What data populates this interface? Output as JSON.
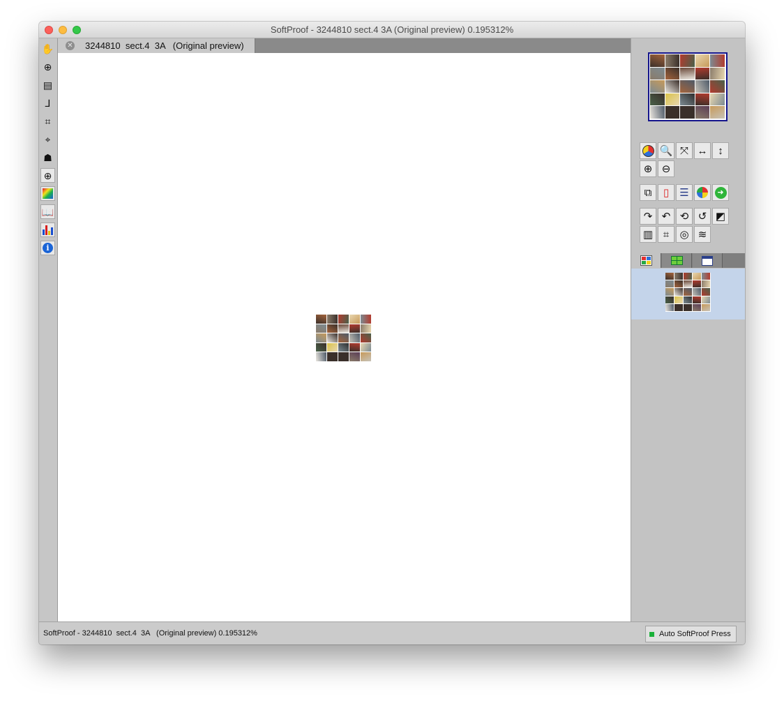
{
  "window": {
    "title": "SoftProof - 3244810  sect.4  3A   (Original preview) 0.195312%"
  },
  "left_toolbar": {
    "tools": [
      {
        "name": "hand-tool",
        "icon": "hand-icon",
        "glyph": "✋"
      },
      {
        "name": "zoom-tool",
        "icon": "zoom-in-icon",
        "glyph": "⊕"
      },
      {
        "name": "page-info-tool",
        "icon": "page-list-icon",
        "glyph": "▤"
      },
      {
        "name": "measure-tool",
        "icon": "ruler-icon",
        "glyph": "⅃"
      },
      {
        "name": "crop-tool",
        "icon": "crop-icon",
        "glyph": "⌗"
      },
      {
        "name": "densitometer-tool",
        "icon": "crosshair-icon",
        "glyph": "⌖"
      },
      {
        "name": "ink-tool",
        "icon": "ink-dropper-icon",
        "glyph": "☗"
      },
      {
        "name": "registration-tool",
        "icon": "registration-mark-icon",
        "glyph": "⊕"
      },
      {
        "name": "color-separation-tool",
        "icon": "color-square-icon",
        "glyph": ""
      },
      {
        "name": "book-tool",
        "icon": "open-book-icon",
        "glyph": "📖"
      },
      {
        "name": "histogram-tool",
        "icon": "bar-chart-icon",
        "glyph": ""
      },
      {
        "name": "info-tool",
        "icon": "info-icon",
        "glyph": "i"
      }
    ]
  },
  "tabs": [
    {
      "label": "3244810  sect.4  3A   (Original preview)"
    }
  ],
  "right_panel": {
    "view_buttons_row1": [
      {
        "name": "color-lens-button",
        "icon": "color-lens-icon",
        "glyph": "◉"
      },
      {
        "name": "page-inspect-button",
        "icon": "page-magnify-icon",
        "glyph": "🔍"
      },
      {
        "name": "fit-window-button",
        "icon": "expand-arrows-icon",
        "glyph": "⤧"
      },
      {
        "name": "fit-width-button",
        "icon": "horizontal-arrows-icon",
        "glyph": "↔"
      },
      {
        "name": "fit-height-button",
        "icon": "vertical-arrows-icon",
        "glyph": "↕"
      }
    ],
    "view_buttons_row2": [
      {
        "name": "zoom-in-button",
        "icon": "zoom-in-icon",
        "glyph": "⊕"
      },
      {
        "name": "zoom-out-button",
        "icon": "zoom-out-icon",
        "glyph": "⊖"
      }
    ],
    "action_buttons": [
      {
        "name": "overlay-button",
        "icon": "overlap-pages-icon",
        "glyph": "⧉"
      },
      {
        "name": "pdf-page-button",
        "icon": "red-page-icon",
        "glyph": "▯"
      },
      {
        "name": "window-list-button",
        "icon": "window-icon",
        "glyph": "☰"
      },
      {
        "name": "color-wheel-button",
        "icon": "color-wheel-icon",
        "glyph": "◕"
      },
      {
        "name": "next-button",
        "icon": "green-arrow-icon",
        "glyph": "➜"
      }
    ],
    "transform_buttons_row1": [
      {
        "name": "rotate-right-button",
        "icon": "curve-arrow-right-icon",
        "glyph": "↷"
      },
      {
        "name": "rotate-left-button",
        "icon": "curve-arrow-left-icon",
        "glyph": "↶"
      },
      {
        "name": "flip-button",
        "icon": "flip-arrows-icon",
        "glyph": "⟲"
      },
      {
        "name": "reset-rotation-button",
        "icon": "reset-icon",
        "glyph": "↺"
      },
      {
        "name": "negative-button",
        "icon": "invert-icon",
        "glyph": "◩"
      }
    ],
    "transform_buttons_row2": [
      {
        "name": "book-view-button",
        "icon": "book-icon",
        "glyph": "▥"
      },
      {
        "name": "crop-marks-button",
        "icon": "crop-marks-icon",
        "glyph": "⌗"
      },
      {
        "name": "target-button",
        "icon": "target-icon",
        "glyph": "◎"
      },
      {
        "name": "curves-button",
        "icon": "curves-icon",
        "glyph": "≋"
      }
    ],
    "panel_tabs": [
      {
        "name": "tab-thumbnails",
        "icon": "thumbnail-grid-icon"
      },
      {
        "name": "tab-signatures",
        "icon": "green-grid-icon"
      },
      {
        "name": "tab-list",
        "icon": "list-window-icon"
      }
    ]
  },
  "status_bar": {
    "text": "SoftProof - 3244810  sect.4  3A   (Original preview) 0.195312%",
    "press_button_label": "Auto SoftProof Press",
    "press_status_color": "#1bb13a"
  },
  "colors": {
    "selection_highlight": "#c4d4ea",
    "navigator_border": "#14148c"
  }
}
